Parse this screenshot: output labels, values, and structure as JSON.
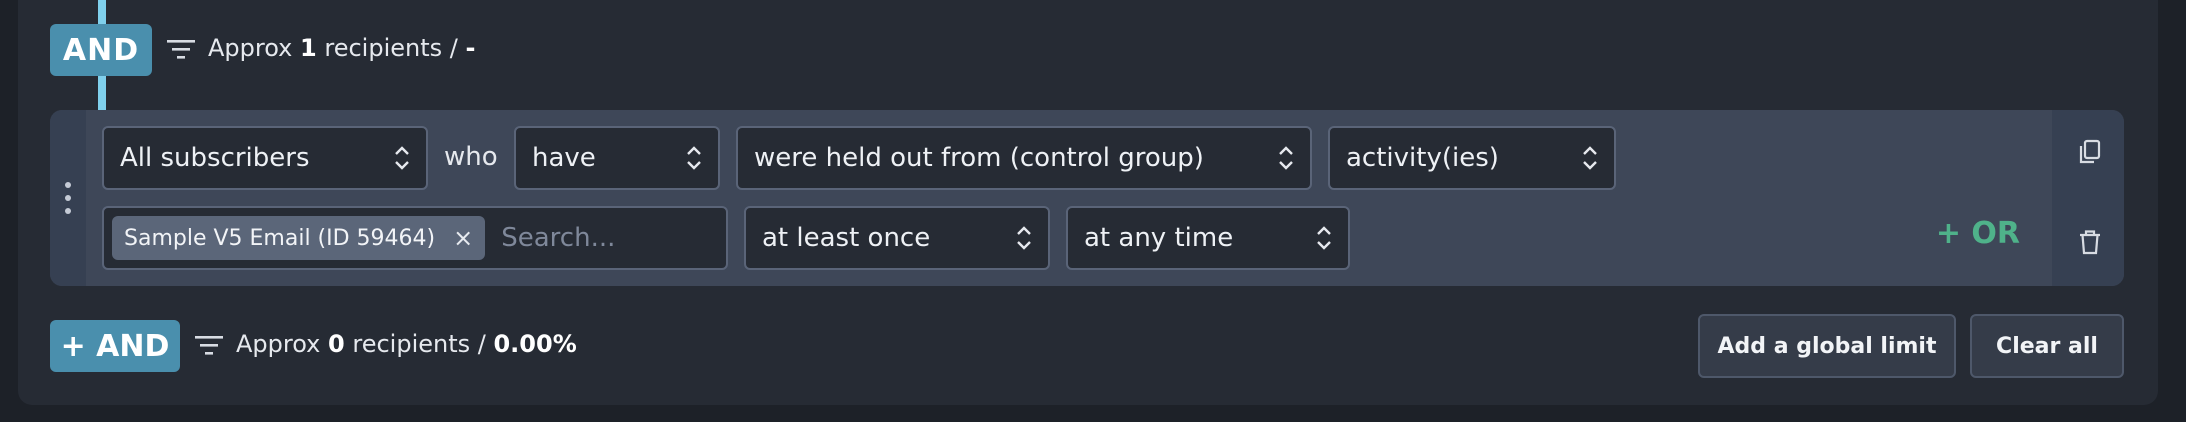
{
  "top": {
    "operator": "AND",
    "approx_prefix": "Approx",
    "approx_count": "1",
    "approx_suffix": "recipients /",
    "approx_percent": "-"
  },
  "condition": {
    "audience": "All subscribers",
    "who_label": "who",
    "verb": "have",
    "action": "were held out from (control group)",
    "object": "activity(ies)",
    "tag_label": "Sample V5 Email (ID 59464)",
    "tag_remove": "×",
    "search_placeholder": "Search...",
    "frequency": "at least once",
    "timeframe": "at any time",
    "or_label": "+ OR"
  },
  "bottom": {
    "add_and_label": "+ AND",
    "approx_prefix": "Approx",
    "approx_count": "0",
    "approx_suffix": "recipients /",
    "approx_percent": "0.00%",
    "global_limit_label": "Add a global limit",
    "clear_label": "Clear all"
  },
  "icons": {
    "filter": "filter-icon",
    "copy": "copy-icon",
    "delete": "trash-icon",
    "drag": "drag-handle-icon"
  },
  "colors": {
    "accent": "#4a8fad",
    "connector": "#7fd0ec",
    "or": "#4fb28a"
  }
}
